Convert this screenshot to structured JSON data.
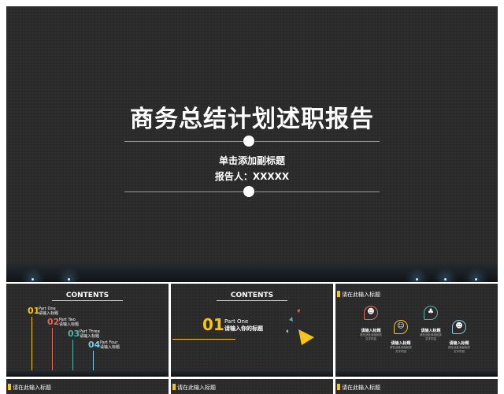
{
  "main": {
    "title": "商务总结计划述职报告",
    "subtitle": "单击添加副标题",
    "reporter": "报告人：XXXXX"
  },
  "thumb1": {
    "heading": "CONTENTS",
    "items": [
      {
        "num": "01",
        "part": "Part One",
        "label": "请输入标题",
        "color": "#f5c518"
      },
      {
        "num": "02",
        "part": "Part Two",
        "label": "请输入标题",
        "color": "#e8675a"
      },
      {
        "num": "03",
        "part": "Part Three",
        "label": "请输入标题",
        "color": "#4db6a6"
      },
      {
        "num": "04",
        "part": "Part Four",
        "label": "请输入标题",
        "color": "#7ec8e3"
      }
    ]
  },
  "thumb2": {
    "heading": "CONTENTS",
    "num": "01",
    "part": "Part One",
    "label": "请输入你的标题"
  },
  "thumb3": {
    "header": "请在此输入标题",
    "items": [
      {
        "label": "请输入标题",
        "desc1": "请在此处添加相关",
        "desc2": "文字内容",
        "icon": "person-icon",
        "color": "#e8675a"
      },
      {
        "label": "请输入标题",
        "desc1": "请在此处添加相关",
        "desc2": "文字内容",
        "icon": "presenter-icon",
        "color": "#f5c518"
      },
      {
        "label": "请输入标题",
        "desc1": "请在此处添加相关",
        "desc2": "文字内容",
        "icon": "team-icon",
        "color": "#4db6a6"
      },
      {
        "label": "请输入标题",
        "desc1": "请在此处添加相关",
        "desc2": "文字内容",
        "icon": "user-icon",
        "color": "#7ec8e3"
      }
    ]
  },
  "bottom": [
    {
      "header": "请在此输入标题"
    },
    {
      "header": "请在此输入标题"
    },
    {
      "header": "请在此输入标题"
    }
  ],
  "colors": {
    "accent": "#f5c518",
    "background": "#2a2a2a"
  }
}
